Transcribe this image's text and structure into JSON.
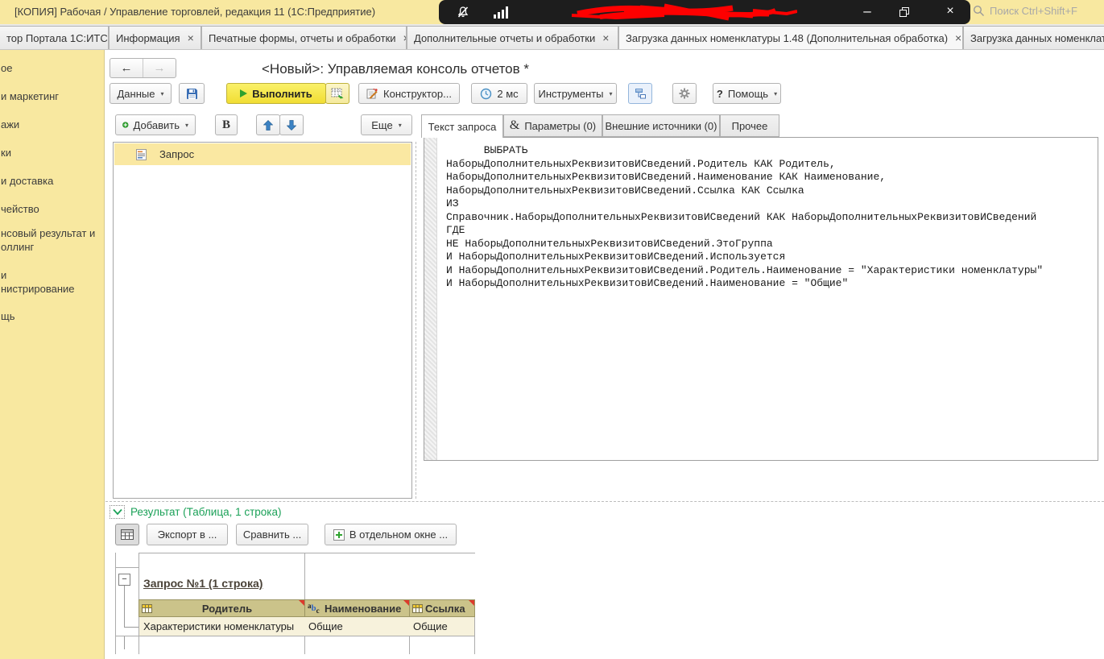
{
  "glyphs": {
    "back": "←",
    "forward": "→",
    "caret": "▾",
    "bold": "B",
    "question": "?",
    "amp": "&",
    "minimize": "–",
    "close": "×",
    "tab_close": "×",
    "collapse": "−",
    "abc": {
      "a": "a",
      "b": "b",
      "c": "c"
    }
  },
  "titlebar": {
    "title": "[КОПИЯ] Рабочая / Управление торговлей, редакция 11  (1С:Предприятие)",
    "search_placeholder": "Поиск Ctrl+Shift+F"
  },
  "window_tabs": [
    {
      "label": "тор Портала 1С:ИТС"
    },
    {
      "label": "Информация"
    },
    {
      "label": "Печатные формы, отчеты и обработки"
    },
    {
      "label": "Дополнительные отчеты и обработки"
    },
    {
      "label": "Загрузка данных номенклатуры 1.48 (Дополнительная обработка)"
    },
    {
      "label": "Загрузка данных номенклат"
    }
  ],
  "sidebar": {
    "items": [
      {
        "lines": [
          "ое"
        ]
      },
      {
        "lines": [
          "и маркетинг"
        ]
      },
      {
        "lines": [
          "ажи"
        ]
      },
      {
        "lines": [
          "ки"
        ]
      },
      {
        "lines": [
          "и доставка"
        ]
      },
      {
        "lines": [
          "чейство"
        ]
      },
      {
        "lines": [
          "нсовый результат и",
          "оллинг"
        ]
      },
      {
        "lines": [
          "и",
          "нистрирование"
        ]
      },
      {
        "lines": [
          "щь"
        ]
      }
    ]
  },
  "page": {
    "title": "<Новый>: Управляемая консоль отчетов *"
  },
  "toolbar": {
    "data_label": "Данные",
    "execute_label": "Выполнить",
    "constructor_label": "Конструктор...",
    "time_label": "2 мс",
    "tools_label": "Инструменты",
    "help_label": "Помощь"
  },
  "left_panel": {
    "add_label": "Добавить",
    "more_label": "Еще",
    "tree_item": "Запрос"
  },
  "query_panel": {
    "tabs": [
      "Текст запроса",
      "Параметры (0)",
      "Внешние источники (0)",
      "Прочее"
    ],
    "lines": [
      "      ВЫБРАТЬ",
      "НаборыДополнительныхРеквизитовИСведений.Родитель КАК Родитель,",
      "НаборыДополнительныхРеквизитовИСведений.Наименование КАК Наименование,",
      "НаборыДополнительныхРеквизитовИСведений.Ссылка КАК Ссылка",
      "ИЗ",
      "Справочник.НаборыДополнительныхРеквизитовИСведений КАК НаборыДополнительныхРеквизитовИСведений",
      "ГДЕ",
      "НЕ НаборыДополнительныхРеквизитовИСведений.ЭтоГруппа",
      "И НаборыДополнительныхРеквизитовИСведений.Используется",
      "И НаборыДополнительныхРеквизитовИСведений.Родитель.Наименование = \"Характеристики номенклатуры\"",
      "И НаборыДополнительныхРеквизитовИСведений.Наименование = \"Общие\""
    ]
  },
  "result": {
    "header": "Результат (Таблица, 1 строка)",
    "export_label": "Экспорт в ...",
    "compare_label": "Сравнить ...",
    "separate_window_label": "В отдельном окне ...",
    "group_title": "Запрос №1 (1 строка)",
    "columns": [
      {
        "name": "Родитель",
        "icon": "table-icon"
      },
      {
        "name": "Наименование",
        "icon": "abc-icon"
      },
      {
        "name": "Ссылка",
        "icon": "table-icon"
      }
    ],
    "rows": [
      [
        "Характеристики номенклатуры",
        "Общие",
        "Общие"
      ]
    ]
  },
  "colors": {
    "accent_yellow": "#F8E8A0",
    "execute_yellow": "#F3E13A",
    "result_green": "#1BA158",
    "table_header_khaki": "#CBC38A",
    "table_row_cream": "#F7F2DC",
    "marker_red": "#DD3A2C"
  }
}
